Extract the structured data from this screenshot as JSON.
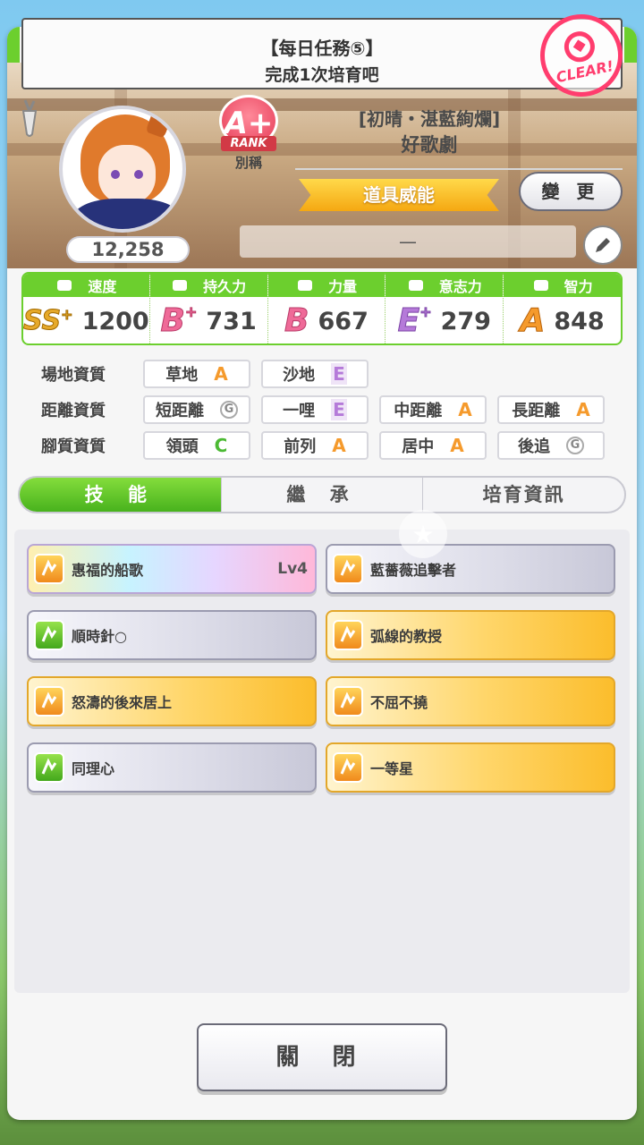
{
  "mission": {
    "title": "【每日任務⑤】",
    "subtitle": "完成1次培育吧",
    "stamp": "CLEAR!"
  },
  "profile": {
    "fans": "12,258",
    "rank": "A+",
    "rank_ribbon": "RANK",
    "nickname_label": "別稱",
    "epithet": "[初晴・湛藍絢爛]",
    "name": "好歌劇",
    "tag": "道具威能",
    "change_label": "變 更",
    "comment": "—"
  },
  "stats": [
    {
      "label": "速度",
      "grade": "SS",
      "plus": "+",
      "value": "1200",
      "icon": "shoe-icon"
    },
    {
      "label": "持久力",
      "grade": "B",
      "plus": "+",
      "value": "731",
      "icon": "heart-icon"
    },
    {
      "label": "力量",
      "grade": "B",
      "plus": "",
      "value": "667",
      "icon": "muscle-icon"
    },
    {
      "label": "意志力",
      "grade": "E",
      "plus": "+",
      "value": "279",
      "icon": "flame-icon"
    },
    {
      "label": "智力",
      "grade": "A",
      "plus": "",
      "value": "848",
      "icon": "graduation-cap-icon"
    }
  ],
  "aptitudes": {
    "track_label": "場地資質",
    "distance_label": "距離資質",
    "style_label": "腳質資質",
    "track": [
      {
        "name": "草地",
        "grade": "A"
      },
      {
        "name": "沙地",
        "grade": "E"
      }
    ],
    "distance": [
      {
        "name": "短距離",
        "grade": "G"
      },
      {
        "name": "一哩",
        "grade": "E"
      },
      {
        "name": "中距離",
        "grade": "A"
      },
      {
        "name": "長距離",
        "grade": "A"
      }
    ],
    "style": [
      {
        "name": "領頭",
        "grade": "C"
      },
      {
        "name": "前列",
        "grade": "A"
      },
      {
        "name": "居中",
        "grade": "A"
      },
      {
        "name": "後追",
        "grade": "G"
      }
    ]
  },
  "tabs": [
    "技 能",
    "繼 承",
    "培育資訊"
  ],
  "skills": [
    {
      "name": "惠福的船歌",
      "level": "Lv4",
      "style": "rainbow",
      "icon": "orange"
    },
    {
      "name": "藍薔薇追擊者",
      "level": "",
      "style": "white",
      "icon": "orange"
    },
    {
      "name": "順時針○",
      "level": "",
      "style": "white",
      "icon": "green"
    },
    {
      "name": "弧線的教授",
      "level": "",
      "style": "gold",
      "icon": "orange"
    },
    {
      "name": "怒濤的後來居上",
      "level": "",
      "style": "gold",
      "icon": "orange"
    },
    {
      "name": "不屈不撓",
      "level": "",
      "style": "gold",
      "icon": "orange"
    },
    {
      "name": "同理心",
      "level": "",
      "style": "white",
      "icon": "green"
    },
    {
      "name": "一等星",
      "level": "",
      "style": "gold",
      "icon": "orange"
    }
  ],
  "close_label": "關 閉",
  "colors": {
    "accent_green": "#6ccf2e",
    "gold": "#fbbd2c",
    "pink": "#ff3d6e"
  }
}
